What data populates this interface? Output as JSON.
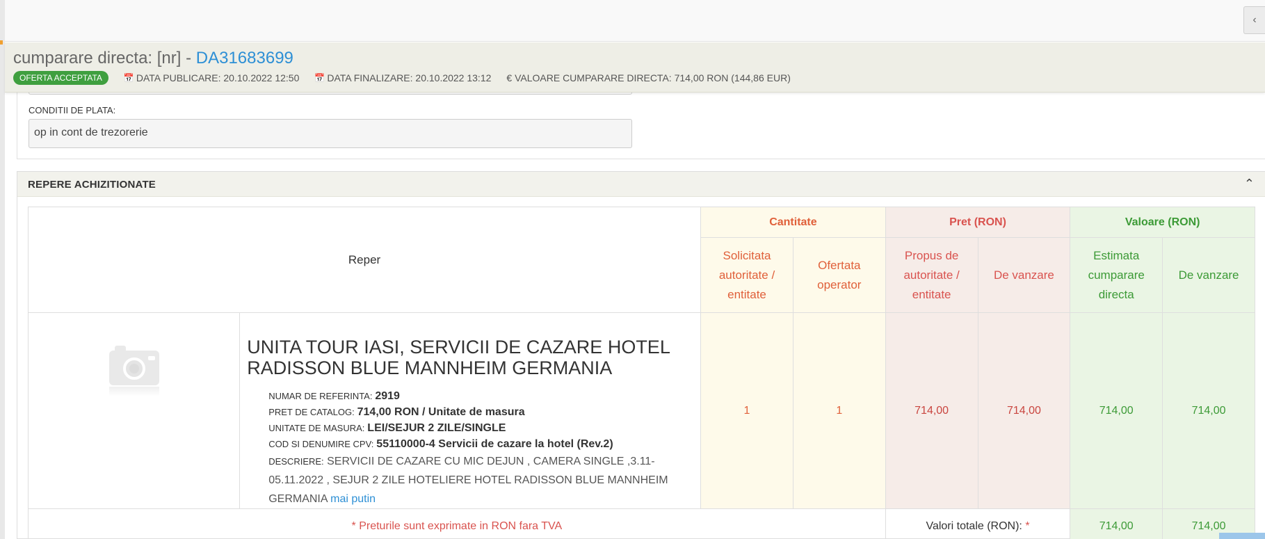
{
  "header": {
    "title_prefix": "cumparare directa: [nr] - ",
    "code": "DA31683699",
    "badge": "OFERTA ACCEPTATA",
    "data_publicare": "DATA PUBLICARE: 20.10.2022 12:50",
    "data_finalizare": "DATA FINALIZARE: 20.10.2022 13:12",
    "valoare": "€ VALOARE CUMPARARE DIRECTA: 714,00  RON (144,86  EUR)",
    "calendar_icon": "calendar-icon",
    "collapse_icon": "chevron-left-icon"
  },
  "payment": {
    "label": "CONDITII DE PLATA:",
    "value": "op in cont de trezorerie"
  },
  "section": {
    "title": "REPERE ACHIZITIONATE",
    "toggle_icon": "chevron-up-icon"
  },
  "table": {
    "reper_header": "Reper",
    "groups": {
      "cantitate": "Cantitate",
      "pret": "Pret (RON)",
      "valoare": "Valoare (RON)"
    },
    "subheaders": {
      "solicitata": "Solicitata autoritate / entitate",
      "ofertata": "Ofertata operator",
      "propus": "Propus de autoritate / entitate",
      "de_vanzare_pret": "De vanzare",
      "estimata": "Estimata cumparare directa",
      "de_vanzare_val": "De vanzare"
    },
    "item": {
      "image_icon": "camera-placeholder-icon",
      "title": "UNITA TOUR IASI, SERVICII DE CAZARE HOTEL RADISSON BLUE MANNHEIM GERMANIA",
      "ref_label": "NUMAR DE REFERINTA:",
      "ref_value": "2919",
      "catalog_label": "PRET DE CATALOG:",
      "catalog_value": "714,00  RON / Unitate de masura",
      "um_label": "UNITATE DE MASURA:",
      "um_value": "LEI/SEJUR 2 ZILE/SINGLE",
      "cpv_label": "COD SI DENUMIRE CPV:",
      "cpv_value": "55110000-4 Servicii de cazare la hotel (Rev.2)",
      "descr_label": "DESCRIERE:",
      "descr_value": "SERVICII DE CAZARE CU MIC DEJUN , CAMERA SINGLE ,3.11-05.11.2022 , SEJUR 2 ZILE HOTELIERE HOTEL RADISSON BLUE MANNHEIM GERMANIA",
      "more_link": "mai putin",
      "solicitata": "1",
      "ofertata": "1",
      "propus": "714,00",
      "de_vanzare_pret": "714,00",
      "estimata": "714,00",
      "de_vanzare_val": "714,00"
    },
    "footer": {
      "note": "* Preturile sunt exprimate in RON fara TVA",
      "totals_label": "Valori totale (RON):",
      "asterisk": "*",
      "total_estimata": "714,00",
      "total_vanzare": "714,00"
    }
  },
  "colors": {
    "link": "#2d8fd5",
    "badge": "#3f9f3f",
    "cantitate": "#e0603a",
    "pret": "#d9534f",
    "valoare": "#3c9a36"
  }
}
